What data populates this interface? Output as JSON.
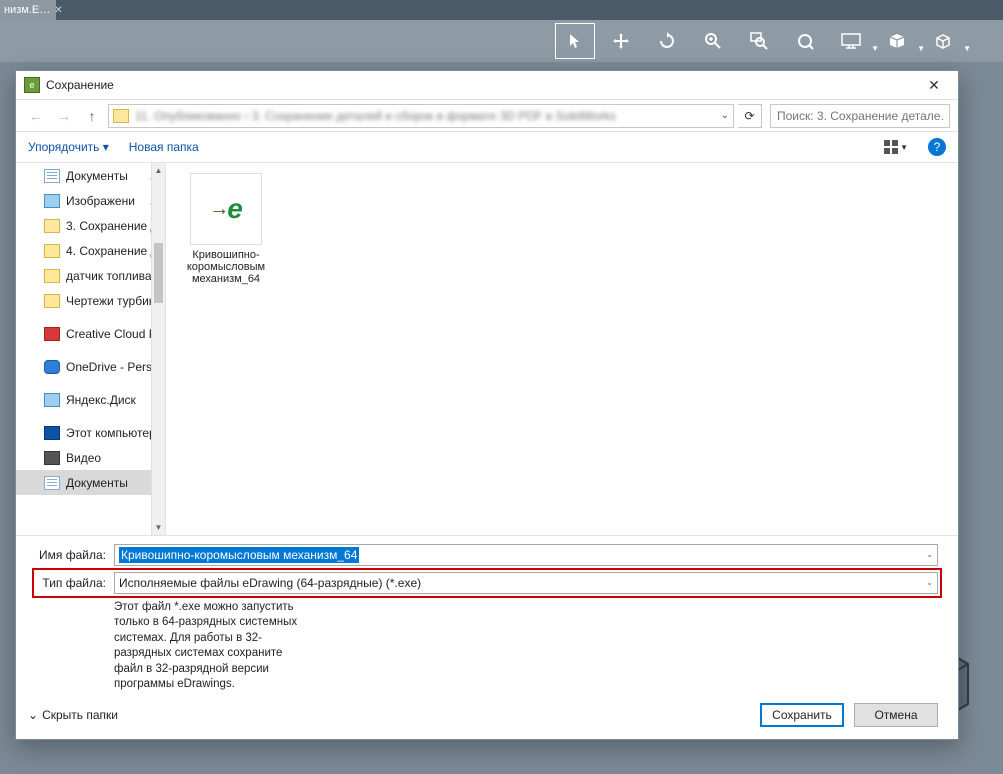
{
  "bg": {
    "tab_label": "низм.E…",
    "toolbar": {
      "cursor": "↖",
      "move": "✥",
      "refresh": "⟳",
      "zoom": "🔍",
      "zoom_area": "🔍",
      "fit": "🔍",
      "display": "▭",
      "package": "📦",
      "cube": "◫"
    }
  },
  "dialog": {
    "title": "Сохранение",
    "close": "✕",
    "nav": {
      "back": "←",
      "fwd": "→",
      "up": "↑",
      "path_blur": "11. Опубликованно  ›  3. Сохранение деталей и сборок в формате 3D PDF в SolidWorks",
      "dropdown": "⌄",
      "refresh": "⟳",
      "search_placeholder": "Поиск: 3. Сохранение детале…"
    },
    "commands": {
      "organize": "Упорядочить  ▾",
      "new_folder": "Новая папка",
      "view": "▦ ▾",
      "help": "?"
    },
    "tree": [
      {
        "icon": "doc",
        "label": "Документы",
        "pin": true
      },
      {
        "icon": "img",
        "label": "Изображени",
        "pin": true
      },
      {
        "icon": "folder",
        "label": "3. Сохранение д",
        "pin": false
      },
      {
        "icon": "folder",
        "label": "4. Сохранение д",
        "pin": false
      },
      {
        "icon": "folder",
        "label": "датчик топлива",
        "pin": false
      },
      {
        "icon": "folder",
        "label": "Чертежи турбин",
        "pin": false
      },
      {
        "icon": "cc",
        "label": "Creative Cloud Fil",
        "pin": false,
        "gap": true
      },
      {
        "icon": "cloud",
        "label": "OneDrive - Person",
        "pin": false,
        "gap": true
      },
      {
        "icon": "img",
        "label": "Яндекс.Диск",
        "pin": false,
        "gap": true
      },
      {
        "icon": "pc",
        "label": "Этот компьютер",
        "pin": false,
        "gap": true
      },
      {
        "icon": "vid",
        "label": "Видео",
        "pin": false
      },
      {
        "icon": "doc",
        "label": "Документы",
        "pin": false,
        "selected": true
      }
    ],
    "files": [
      {
        "name": "Кривошипно-коромысловым механизм_64"
      }
    ],
    "footer": {
      "filename_label": "Имя файла:",
      "filename_value": "Кривошипно-коромысловым механизм_64",
      "filetype_label": "Тип файла:",
      "filetype_value": "Исполняемые файлы eDrawing (64-разрядные) (*.exe)",
      "note": "Этот файл *.exe можно запустить только в 64-разрядных системных системах. Для работы в 32-разрядных системах сохраните файл в 32-разрядной версии программы eDrawings.",
      "hide_folders": "Скрыть папки",
      "save": "Сохранить",
      "cancel": "Отмена"
    }
  }
}
